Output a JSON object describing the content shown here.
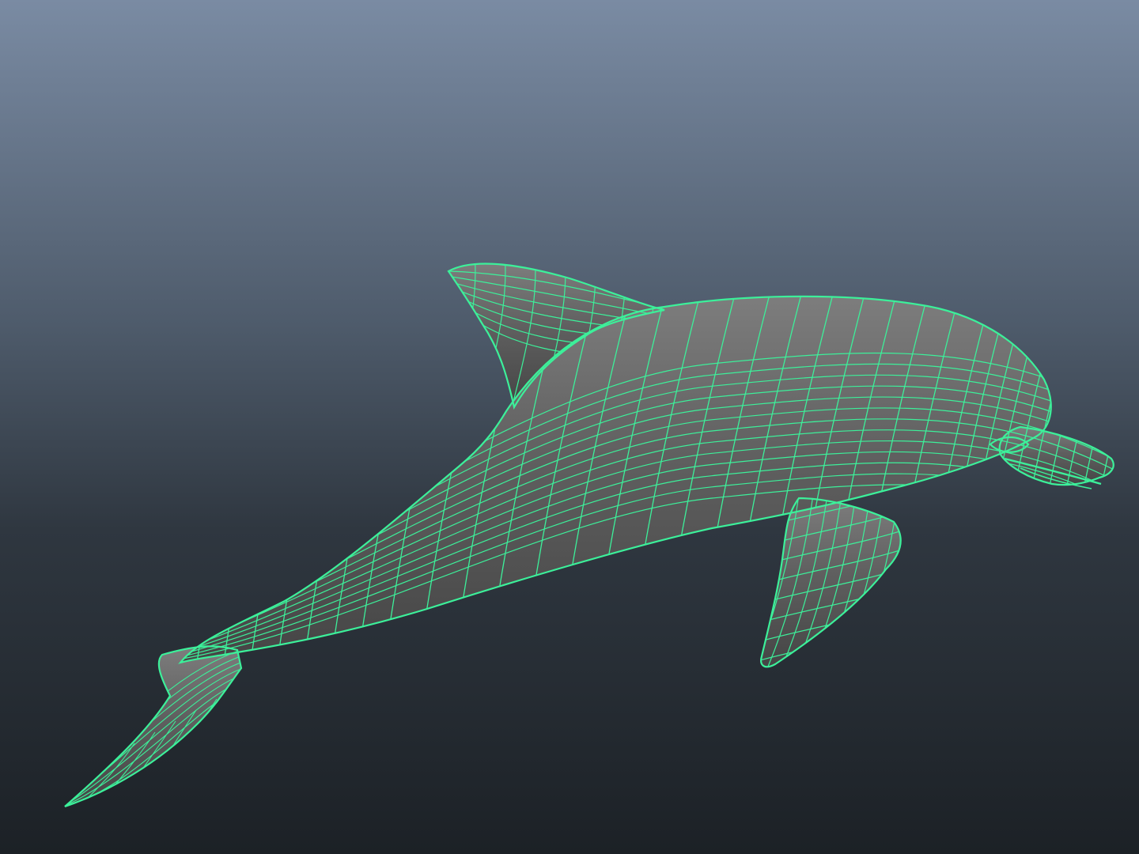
{
  "viewport": {
    "background_top_color": "#7a8ba3",
    "background_bottom_color": "#1c2126"
  },
  "model": {
    "name": "dolphin-mesh",
    "shade_color": "#5f5f5f",
    "shade_highlight_color": "#7d7d7d",
    "shade_dark_color": "#454545",
    "wire_color": "#3cf09a",
    "display_mode": "wireframe-on-shaded"
  }
}
